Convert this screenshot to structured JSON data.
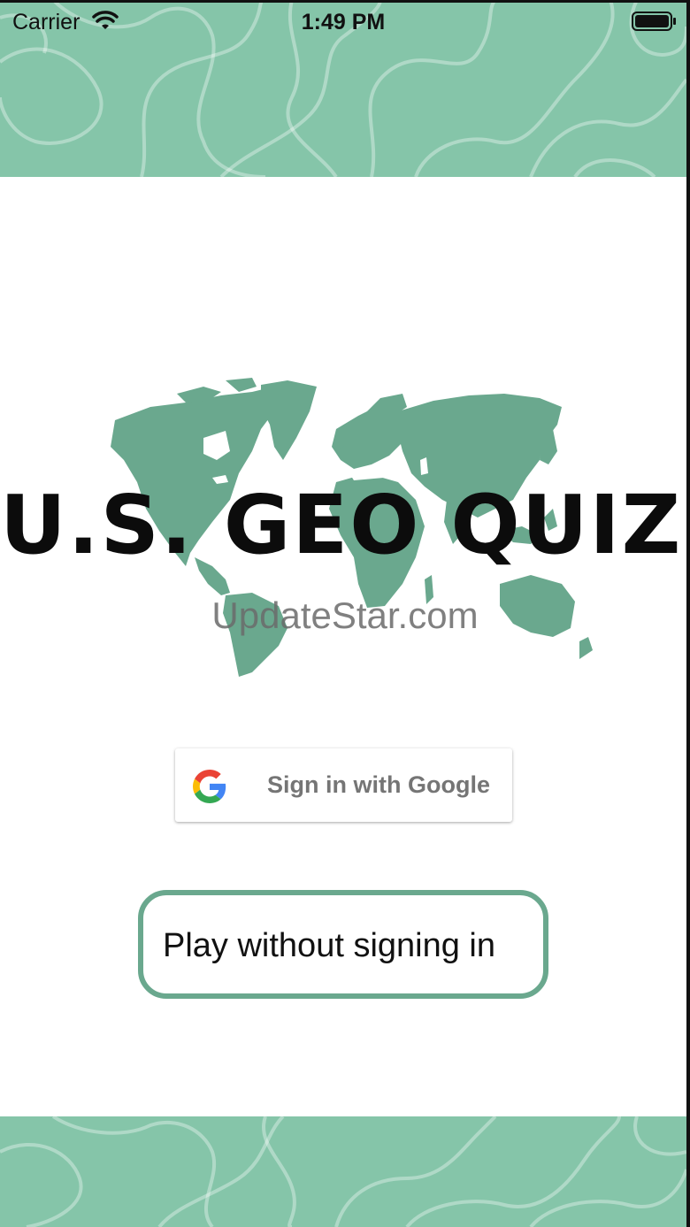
{
  "status_bar": {
    "carrier": "Carrier",
    "time": "1:49 PM",
    "wifi_icon": "wifi-icon",
    "battery_icon": "battery-icon"
  },
  "hero": {
    "title": "U.S. GEO QUIZ",
    "map_icon": "world-map-icon",
    "watermark": "UpdateStar.com"
  },
  "actions": {
    "google_sign_in": "Sign in with Google",
    "google_icon": "google-g-icon",
    "play_without_sign_in": "Play without signing in"
  },
  "colors": {
    "band_green": "#85c5a9",
    "map_green": "#6aa88e",
    "button_border": "#6aa88e"
  }
}
